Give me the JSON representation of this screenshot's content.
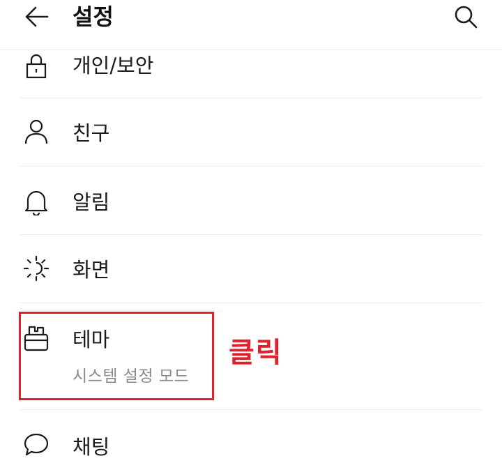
{
  "header": {
    "back_icon": "arrow-left-icon",
    "title": "설정",
    "search_icon": "search-icon"
  },
  "menu": {
    "items": [
      {
        "label": "개인/보안",
        "icon": "lock-icon"
      },
      {
        "label": "친구",
        "icon": "person-icon"
      },
      {
        "label": "알림",
        "icon": "bell-icon"
      },
      {
        "label": "화면",
        "icon": "brightness-icon"
      },
      {
        "label": "테마",
        "icon": "paint-brush-icon",
        "sublabel": "시스템 설정 모드"
      },
      {
        "label": "채팅",
        "icon": "chat-bubble-icon"
      }
    ]
  },
  "annotation": {
    "text": "클릭",
    "color": "#e0202a"
  }
}
